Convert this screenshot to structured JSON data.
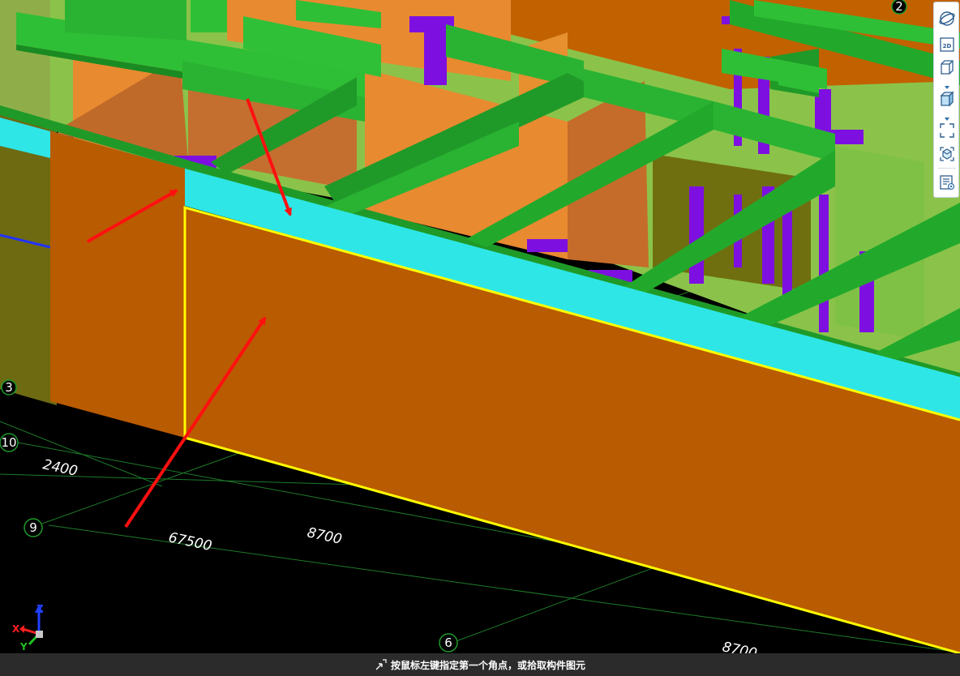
{
  "viewport": {
    "grid_axis_labels": [
      "10",
      "9",
      "6"
    ],
    "partial_axis_labels": [
      "3",
      "2"
    ],
    "dimension_labels": [
      "2400",
      "67500",
      "8700",
      "8700"
    ]
  },
  "coordinate_axes": {
    "x": "X",
    "y": "Y",
    "z": "Z"
  },
  "toolbar": {
    "items": [
      {
        "icon": "orbit-icon",
        "label": ""
      },
      {
        "icon": "view-2d-icon",
        "label": "2D"
      },
      {
        "icon": "cube-wireframe-icon",
        "label": ""
      },
      {
        "icon": "chevron-down-icon",
        "label": ""
      },
      {
        "icon": "cube-shaded-icon",
        "label": ""
      },
      {
        "icon": "chevron-down-icon",
        "label": ""
      },
      {
        "icon": "zoom-extents-icon",
        "label": ""
      },
      {
        "icon": "component-view-icon",
        "label": ""
      },
      {
        "icon": "properties-panel-icon",
        "label": ""
      }
    ]
  },
  "status": {
    "message": "按鼠标左键指定第一个角点，或拾取构件图元"
  },
  "colors": {
    "beam_green": "#22a92b",
    "beam_green_top": "#33c23a",
    "wall_orange": "#b95b00",
    "wall_orange_light": "#e88a30",
    "slab_cyan": "#2ee6e6",
    "column_purple": "#7d10e0",
    "selection_yellow": "#ffff00",
    "annotation_red": "#ff1010",
    "grid_green": "#1d7a2a"
  }
}
